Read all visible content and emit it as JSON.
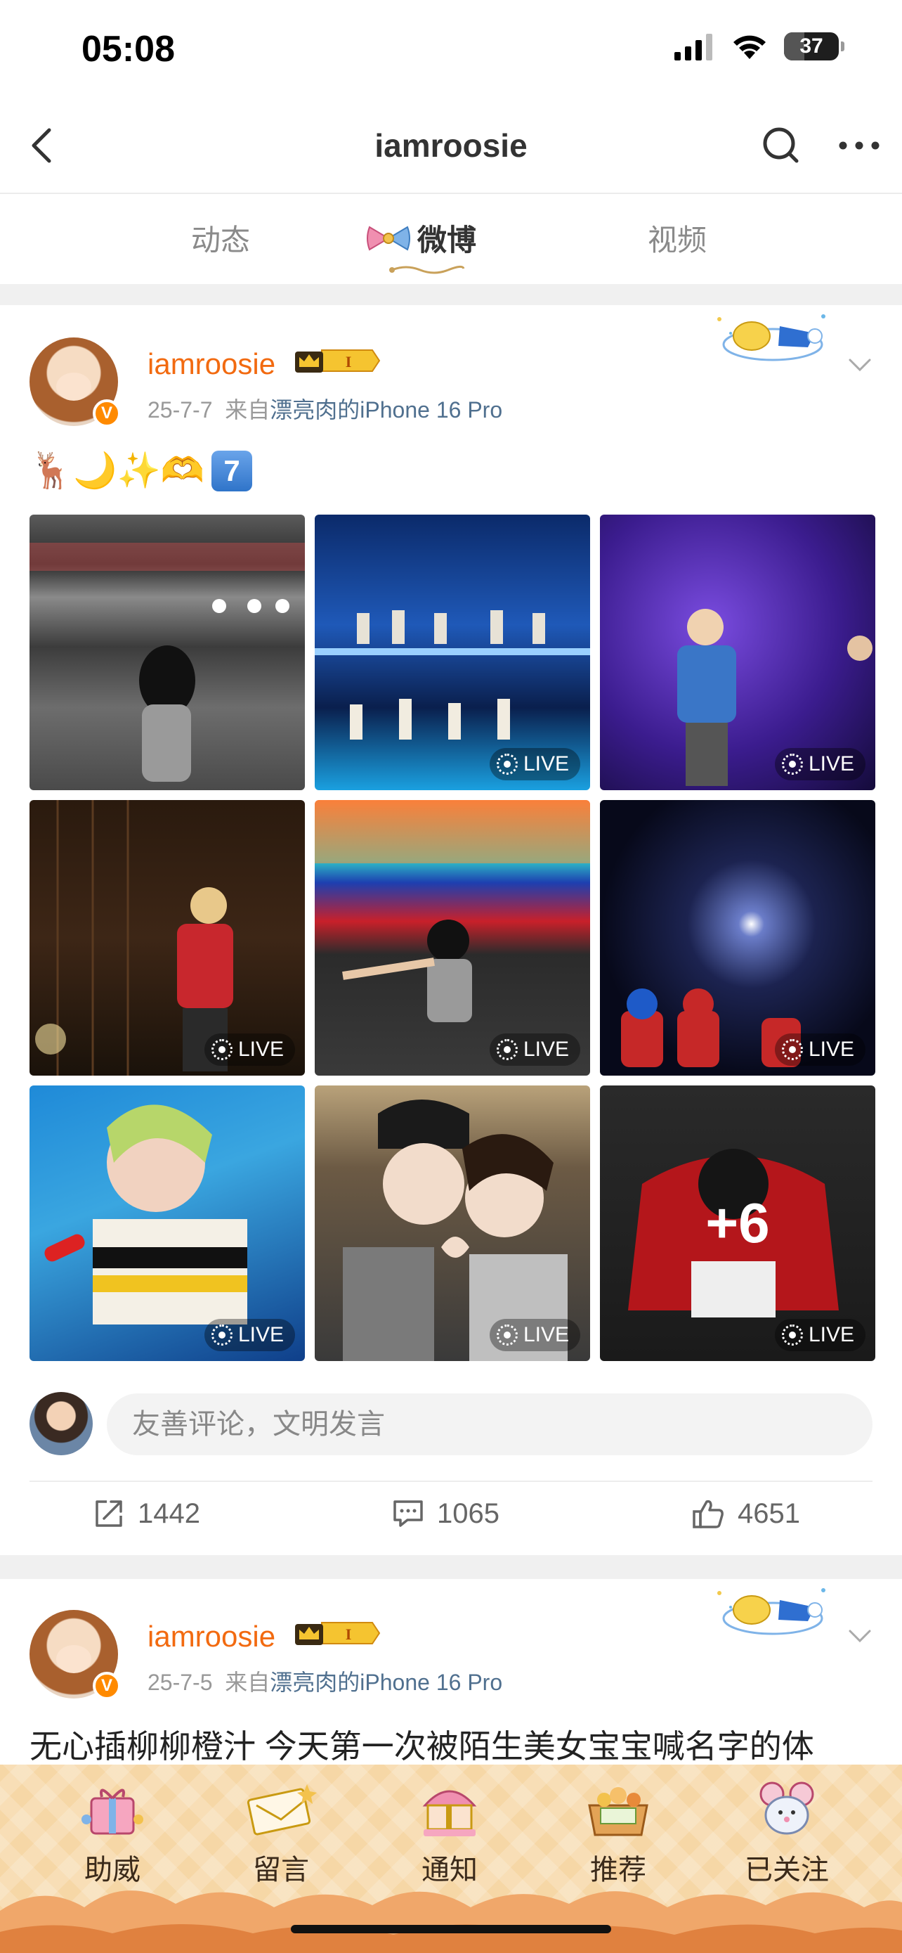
{
  "status_bar": {
    "time": "05:08",
    "battery": "37",
    "battery_level": 0.37
  },
  "nav": {
    "title": "iamroosie"
  },
  "tabs": [
    {
      "label": "动态",
      "active": false
    },
    {
      "label": "微博",
      "active": true
    },
    {
      "label": "视频",
      "active": false
    }
  ],
  "posts": [
    {
      "username": "iamroosie",
      "crown_level": "I",
      "date": "25-7-7",
      "source_prefix": "来自",
      "source": "漂亮肉的iPhone 16 Pro",
      "emoji_text": "🦌🌙✨🫶",
      "keycap": "7",
      "photos": [
        {
          "live": false,
          "theme": "arena"
        },
        {
          "live": true,
          "live_label": "LIVE",
          "theme": "stage-blue"
        },
        {
          "live": true,
          "live_label": "LIVE",
          "theme": "stage-purple"
        },
        {
          "live": true,
          "live_label": "LIVE",
          "theme": "stage-dark"
        },
        {
          "live": true,
          "live_label": "LIVE",
          "theme": "screen"
        },
        {
          "live": true,
          "live_label": "LIVE",
          "theme": "lights"
        },
        {
          "live": true,
          "live_label": "LIVE",
          "theme": "closeup"
        },
        {
          "live": true,
          "live_label": "LIVE",
          "theme": "selfie"
        },
        {
          "live": true,
          "live_label": "LIVE",
          "theme": "red",
          "more": "+6"
        }
      ],
      "comment_placeholder": "友善评论，文明发言",
      "reposts": "1442",
      "comments": "1065",
      "likes": "4651"
    },
    {
      "username": "iamroosie",
      "crown_level": "I",
      "date": "25-7-5",
      "source_prefix": "来自",
      "source": "漂亮肉的iPhone 16 Pro",
      "text": "无心插柳柳橙汁 今天第一次被陌生美女宝宝喊名字的体"
    }
  ],
  "bottom_tabs": [
    {
      "label": "助威",
      "icon": "gift-icon"
    },
    {
      "label": "留言",
      "icon": "letter-icon"
    },
    {
      "label": "通知",
      "icon": "carousel-icon"
    },
    {
      "label": "推荐",
      "icon": "basket-icon"
    },
    {
      "label": "已关注",
      "icon": "mouse-icon"
    }
  ],
  "colors": {
    "username": "#f26a10",
    "source_link": "#50708f",
    "accent": "#ff8a00"
  }
}
